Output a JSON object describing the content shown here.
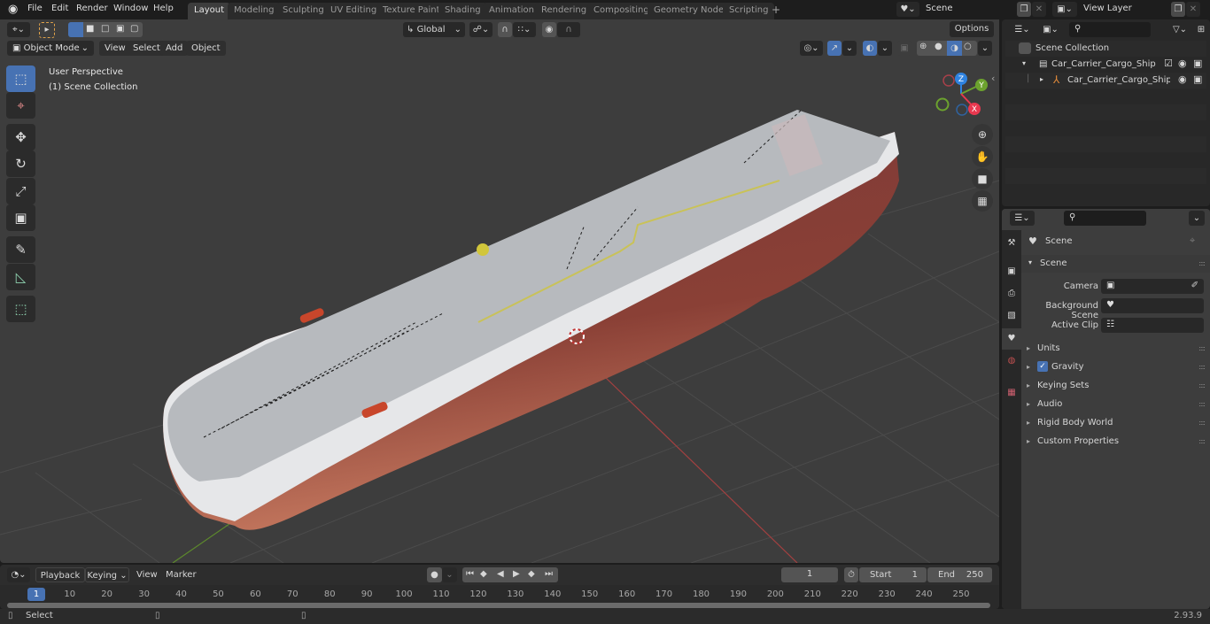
{
  "app": {
    "name": "Blender",
    "version": "2.93.9"
  },
  "topbar": {
    "menus": [
      "File",
      "Edit",
      "Render",
      "Window",
      "Help"
    ],
    "workspace_tabs": [
      "Layout",
      "Modeling",
      "Sculpting",
      "UV Editing",
      "Texture Paint",
      "Shading",
      "Animation",
      "Rendering",
      "Compositing",
      "Geometry Nodes",
      "Scripting"
    ],
    "active_tab": "Layout",
    "add_tab": "+",
    "scene_name": "Scene",
    "view_layer_name": "View Layer"
  },
  "viewport_header": {
    "mode": "Object Mode",
    "menus": [
      "View",
      "Select",
      "Add",
      "Object"
    ],
    "transform_orientation": "Global",
    "options_label": "Options"
  },
  "viewport": {
    "overlay_title": "User Perspective",
    "overlay_collection": "(1) Scene Collection",
    "gizmo_axes": {
      "x": "X",
      "y": "Y",
      "z": "Z"
    },
    "colors": {
      "x": "#e8384f",
      "y": "#6ca22e",
      "z": "#2f83e0",
      "hull_red": "#7d3a3a",
      "hull_orange": "#c0705a",
      "deck": "#b9bcc0",
      "grid_bg": "#3d3d3d",
      "accent": "#4772b3"
    },
    "object": "Car_Carrier_Cargo_Ship"
  },
  "toolbar": {
    "tools": [
      {
        "name": "select-box",
        "icon": "select-box-icon",
        "active": true
      },
      {
        "name": "cursor",
        "icon": "cursor-icon",
        "active": false
      },
      {
        "name": "move",
        "icon": "move-icon",
        "active": false
      },
      {
        "name": "rotate",
        "icon": "rotate-icon",
        "active": false
      },
      {
        "name": "scale",
        "icon": "scale-icon",
        "active": false
      },
      {
        "name": "transform",
        "icon": "transform-icon",
        "active": false
      },
      {
        "name": "annotate",
        "icon": "annotate-icon",
        "active": false
      },
      {
        "name": "measure",
        "icon": "measure-icon",
        "active": false
      },
      {
        "name": "add-cube",
        "icon": "add-cube-icon",
        "active": false
      }
    ]
  },
  "outliner": {
    "root": "Scene Collection",
    "items": [
      {
        "label": "Car_Carrier_Cargo_Ship",
        "type": "collection",
        "expanded": true,
        "checked": true
      },
      {
        "label": "Car_Carrier_Cargo_Ship_",
        "type": "empty",
        "expanded": false
      }
    ]
  },
  "properties": {
    "context_title": "Scene",
    "panel_title": "Scene",
    "fields": [
      {
        "label": "Camera",
        "value": ""
      },
      {
        "label": "Background Scene",
        "value": ""
      },
      {
        "label": "Active Clip",
        "value": ""
      }
    ],
    "subpanels": [
      {
        "label": "Units"
      },
      {
        "label": "Gravity",
        "checkbox": true
      },
      {
        "label": "Keying Sets"
      },
      {
        "label": "Audio"
      },
      {
        "label": "Rigid Body World"
      },
      {
        "label": "Custom Properties"
      }
    ]
  },
  "timeline": {
    "menus": [
      "Playback",
      "Keying",
      "View",
      "Marker"
    ],
    "current_frame": "1",
    "start_label": "Start",
    "start": "1",
    "end_label": "End",
    "end": "250",
    "ticks": [
      "1",
      "10",
      "20",
      "30",
      "40",
      "50",
      "60",
      "70",
      "80",
      "90",
      "100",
      "110",
      "120",
      "130",
      "140",
      "150",
      "160",
      "170",
      "180",
      "190",
      "200",
      "210",
      "220",
      "230",
      "240",
      "250"
    ]
  },
  "statusbar": {
    "left_label": "Select",
    "version": "2.93.9"
  }
}
